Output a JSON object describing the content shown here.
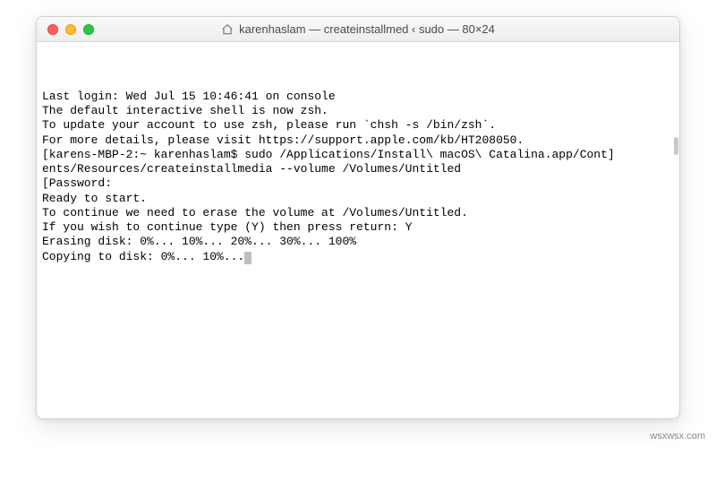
{
  "window": {
    "title": "karenhaslam — createinstallmed ‹ sudo — 80×24"
  },
  "terminal": {
    "lines": [
      "Last login: Wed Jul 15 10:46:41 on console",
      "",
      "The default interactive shell is now zsh.",
      "To update your account to use zsh, please run `chsh -s /bin/zsh`.",
      "For more details, please visit https://support.apple.com/kb/HT208050.",
      "[karens-MBP-2:~ karenhaslam$ sudo /Applications/Install\\ macOS\\ Catalina.app/Cont]",
      "ents/Resources/createinstallmedia --volume /Volumes/Untitled",
      "[Password:",
      "Ready to start.",
      "To continue we need to erase the volume at /Volumes/Untitled.",
      "If you wish to continue type (Y) then press return: Y",
      "Erasing disk: 0%... 10%... 20%... 30%... 100%",
      "Copying to disk: 0%... 10%..."
    ]
  },
  "watermark": "wsxwsx.com"
}
